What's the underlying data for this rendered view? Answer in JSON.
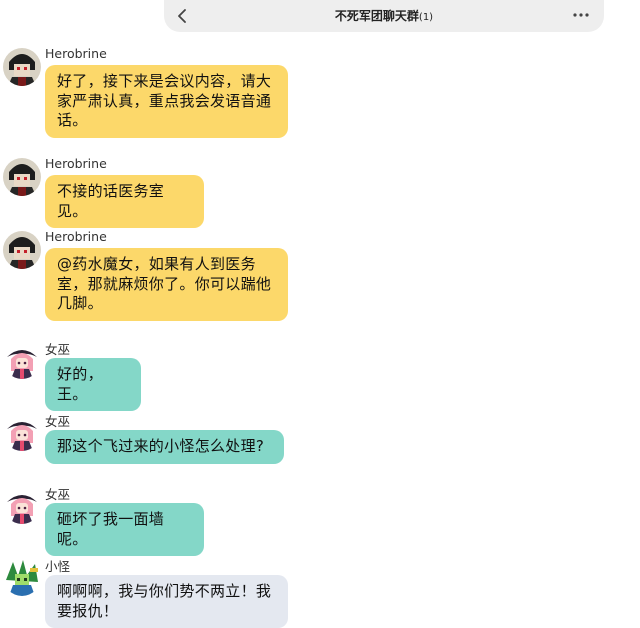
{
  "header": {
    "title": "不死军团聊天群",
    "count": "(1)"
  },
  "messages": [
    {
      "sender": "Herobrine",
      "text": "好了，接下来是会议内容，请大家严肃认真，重点我会发语音通话。"
    },
    {
      "sender": "Herobrine",
      "text": "不接的话医务室见。"
    },
    {
      "sender": "Herobrine",
      "text": "@药水魔女，如果有人到医务室，那就麻烦你了。你可以踹他几脚。"
    },
    {
      "sender": "女巫",
      "text": "好的，王。"
    },
    {
      "sender": "女巫",
      "text": "那这个飞过来的小怪怎么处理?"
    },
    {
      "sender": "女巫",
      "text": "砸坏了我一面墙呢。"
    },
    {
      "sender": "小怪",
      "text": "啊啊啊，我与你们势不两立！我要报仇！"
    }
  ],
  "icons": {
    "back": "chevron-left-icon",
    "more": "more-horizontal-icon"
  },
  "colors": {
    "herobrine_bubble": "#fcd86a",
    "witch_bubble": "#84d7c8",
    "mob_bubble": "#e4e8f0"
  }
}
